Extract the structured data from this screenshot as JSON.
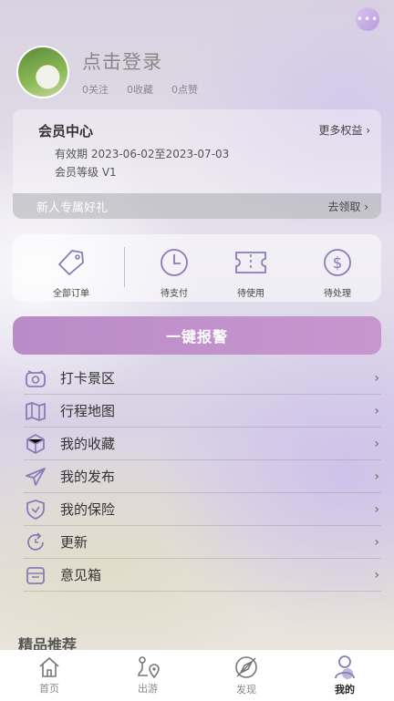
{
  "colors": {
    "accent": "#b98cc7",
    "icon": "#8a7bb8"
  },
  "profile": {
    "login_text": "点击登录",
    "follows": "0关注",
    "favorites": "0收藏",
    "likes": "0点赞"
  },
  "vip": {
    "title": "会员中心",
    "more": "更多权益 ›",
    "validity": "有效期  2023-06-02至2023-07-03",
    "level": "会员等级  V1",
    "gift": "新人专属好礼",
    "claim": "去领取 ›"
  },
  "orders": [
    {
      "label": "全部订单",
      "icon": "tag-icon"
    },
    {
      "label": "待支付",
      "icon": "clock-icon"
    },
    {
      "label": "待使用",
      "icon": "ticket-icon"
    },
    {
      "label": "待处理",
      "icon": "dollar-icon"
    }
  ],
  "alarm": {
    "label": "一键报警"
  },
  "menu": [
    {
      "label": "打卡景区",
      "icon": "camera-icon"
    },
    {
      "label": "行程地图",
      "icon": "map-icon"
    },
    {
      "label": "我的收藏",
      "icon": "box-icon"
    },
    {
      "label": "我的发布",
      "icon": "send-icon"
    },
    {
      "label": "我的保险",
      "icon": "shield-icon"
    },
    {
      "label": "更新",
      "icon": "refresh-icon"
    },
    {
      "label": "意见箱",
      "icon": "mail-icon"
    }
  ],
  "recommend": {
    "title": "精品推荐"
  },
  "tabs": [
    {
      "label": "首页",
      "icon": "home-icon"
    },
    {
      "label": "出游",
      "icon": "route-icon"
    },
    {
      "label": "发现",
      "icon": "compass-icon"
    },
    {
      "label": "我的",
      "icon": "user-icon"
    }
  ]
}
